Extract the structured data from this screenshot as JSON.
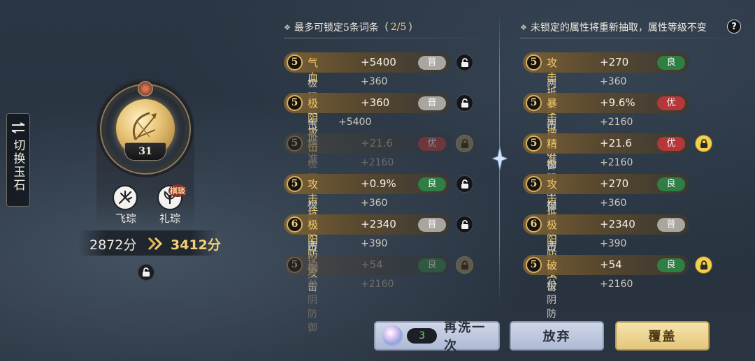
{
  "switch_tab": {
    "label": "切换玉石"
  },
  "jade": {
    "level": "31"
  },
  "skills": [
    {
      "label": "飞琮",
      "icon": "feicong-skill-icon"
    },
    {
      "label": "礼琮",
      "icon": "licong-skill-icon",
      "tag": "棋琰"
    }
  ],
  "score": {
    "old": "2872分",
    "new": "3412分"
  },
  "left_panel": {
    "header_prefix": "最多可锁定5条词条（",
    "header_count": "2/5",
    "header_suffix": "）",
    "rows": [
      {
        "level": "5",
        "main_name": "气血",
        "main_value": "+5400",
        "quality": "普",
        "sub_name": "极阳攻击",
        "sub_value": "+360",
        "locked": false,
        "dim": false
      },
      {
        "level": "5",
        "main_name": "极阴攻击",
        "main_value": "+360",
        "quality": "普",
        "sub_name": "气血",
        "sub_value": "+5400",
        "locked": false,
        "dim": false
      },
      {
        "level": "5",
        "main_name": "精准",
        "main_value": "+21.6",
        "quality": "优",
        "sub_name": "极阴防御",
        "sub_value": "+2160",
        "locked": true,
        "dim": true
      },
      {
        "level": "5",
        "main_name": "攻击抗率",
        "main_value": "+0.9%",
        "quality": "良",
        "sub_name": "极阴攻击",
        "sub_value": "+360",
        "locked": false,
        "dim": false
      },
      {
        "level": "6",
        "main_name": "极阳防御",
        "main_value": "+2340",
        "quality": "普",
        "sub_name": "两仪攻击",
        "sub_value": "+390",
        "locked": false,
        "dim": false
      },
      {
        "level": "5",
        "main_name": "破穴",
        "main_value": "+54",
        "quality": "良",
        "sub_name": "极阴防御",
        "sub_value": "+2160",
        "locked": true,
        "dim": true
      }
    ]
  },
  "right_panel": {
    "header": "未锁定的属性将重新抽取，属性等级不变",
    "help": "?",
    "rows": [
      {
        "level": "5",
        "main_name": "攻击抵抗",
        "main_value": "+270",
        "quality": "良",
        "sub_name": "两仪攻击",
        "sub_value": "+360",
        "locked": false
      },
      {
        "level": "5",
        "main_name": "暴击增伤",
        "main_value": "+9.6%",
        "quality": "优",
        "sub_name": "两仪防御",
        "sub_value": "+2160",
        "locked": false
      },
      {
        "level": "5",
        "main_name": "精准",
        "main_value": "+21.6",
        "quality": "优",
        "sub_name": "极阴防御",
        "sub_value": "+2160",
        "locked": true
      },
      {
        "level": "5",
        "main_name": "攻击抵抗",
        "main_value": "+270",
        "quality": "良",
        "sub_name": "极阴攻击",
        "sub_value": "+360",
        "locked": false
      },
      {
        "level": "6",
        "main_name": "极阳防御",
        "main_value": "+2340",
        "quality": "普",
        "sub_name": "两仪攻击",
        "sub_value": "+390",
        "locked": false
      },
      {
        "level": "5",
        "main_name": "破穴",
        "main_value": "+54",
        "quality": "良",
        "sub_name": "极阴防御",
        "sub_value": "+2160",
        "locked": true
      }
    ]
  },
  "buttons": {
    "rewash_cost": "3",
    "rewash_label": "再洗一次",
    "give_up_label": "放弃",
    "cover_label": "覆盖"
  },
  "colors": {
    "gold_text": "#f3cc6e",
    "quality_pu": "#a9a6a2",
    "quality_liang": "#2f7e43",
    "quality_you": "#b5373a",
    "lock_active": "#f1cf4f"
  }
}
